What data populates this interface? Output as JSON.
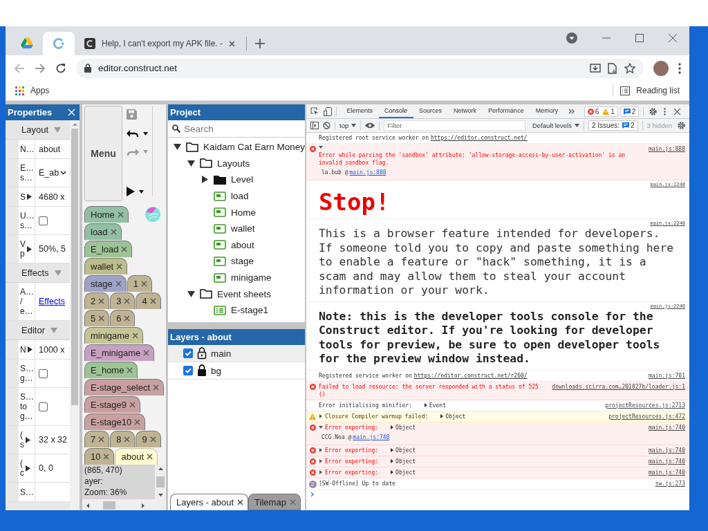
{
  "browser": {
    "tabs": [
      {
        "kind": "drive",
        "selected": false
      },
      {
        "kind": "construct",
        "selected": true
      },
      {
        "kind": "page",
        "title": "Help, I can't export my APK file. -",
        "selected": false
      }
    ],
    "address": "editor.construct.net",
    "bookmarks": [
      {
        "label": "Apps"
      }
    ],
    "reading_list": "Reading list"
  },
  "properties": {
    "title": "Properties",
    "sections": [
      {
        "title": "Layout",
        "expanded": true,
        "rows": [
          {
            "label": "N…",
            "kind": "text",
            "value": "about"
          },
          {
            "label": "E…\ns…",
            "kind": "select",
            "value": "E_ab"
          },
          {
            "label": "S",
            "kind": "expand",
            "value": "4680 x"
          },
          {
            "label": "U…\ns…",
            "kind": "check",
            "checked": false
          },
          {
            "label": "V\np",
            "kind": "expand",
            "value": "50%, 5"
          }
        ]
      },
      {
        "title": "Effects",
        "expanded": true,
        "rows": [
          {
            "label": "A…\n/\ne…",
            "kind": "link",
            "value": "Effects"
          }
        ]
      },
      {
        "title": "Editor",
        "expanded": true,
        "rows": [
          {
            "label": "N",
            "kind": "expand",
            "value": "1000 x"
          },
          {
            "label": "S…\ng…",
            "kind": "check",
            "checked": false
          },
          {
            "label": "S…\nto\ng…",
            "kind": "check",
            "checked": false
          },
          {
            "label": "(\ns",
            "kind": "expand",
            "value": "32 x 32"
          },
          {
            "label": "(\nc",
            "kind": "expand",
            "value": "0, 0"
          },
          {
            "label": "S…",
            "kind": "blank"
          }
        ]
      }
    ]
  },
  "editor_toolbar": {
    "menu": "Menu",
    "buttons": [
      {
        "kind": "save",
        "dropdown": false,
        "disabled": true
      },
      {
        "kind": "undo",
        "dropdown": true,
        "disabled": false
      },
      {
        "kind": "redo",
        "dropdown": true,
        "disabled": true
      },
      {
        "kind": "play",
        "dropdown": true,
        "disabled": false
      }
    ]
  },
  "layout_tabs": {
    "rows": [
      [
        {
          "label": "Home",
          "color": "#93bfa3",
          "selected": false
        }
      ],
      [
        {
          "label": "load",
          "color": "#93bfa3",
          "selected": false
        }
      ],
      [
        {
          "label": "E_load",
          "color": "#9dc495",
          "selected": false
        }
      ],
      [
        {
          "label": "wallet",
          "color": "#bdbd8e",
          "selected": false
        }
      ],
      [
        {
          "label": "stage",
          "color": "#9ea3c7",
          "selected": false
        },
        {
          "label": "1",
          "color": "#bfb393",
          "selected": false
        }
      ],
      [
        {
          "label": "2",
          "color": "#bfb393",
          "selected": false
        },
        {
          "label": "3",
          "color": "#bfb393",
          "selected": false
        },
        {
          "label": "4",
          "color": "#bfb393",
          "selected": false
        }
      ],
      [
        {
          "label": "5",
          "color": "#bfb393",
          "selected": false
        },
        {
          "label": "6",
          "color": "#bfb393",
          "selected": false
        }
      ],
      [
        {
          "label": "minigame",
          "color": "#c5c596",
          "selected": false
        }
      ],
      [
        {
          "label": "E_minigame",
          "color": "#c7a0c2",
          "selected": false
        }
      ],
      [
        {
          "label": "E_home",
          "color": "#9dc495",
          "selected": false
        }
      ],
      [
        {
          "label": "E-stage_select",
          "color": "#c9a0a0",
          "selected": false
        }
      ],
      [
        {
          "label": "E-stage9",
          "color": "#c9a0a0",
          "selected": false
        }
      ],
      [
        {
          "label": "E-stage10",
          "color": "#c9a0a0",
          "selected": false
        }
      ],
      [
        {
          "label": "7",
          "color": "#bfb393",
          "selected": false
        },
        {
          "label": "8",
          "color": "#bfb393",
          "selected": false
        },
        {
          "label": "9",
          "color": "#bfb393",
          "selected": false
        }
      ],
      [
        {
          "label": "10",
          "color": "#bfb393",
          "selected": false
        },
        {
          "label": "about",
          "selected": true
        }
      ]
    ]
  },
  "status": [
    "(865, 470)",
    "ayer:",
    "Zoom: 36%"
  ],
  "project": {
    "title": "Project",
    "search": {
      "placeholder": "Search"
    },
    "tree": [
      {
        "label": "Kaidam Cat Earn Money",
        "kind": "folder",
        "expanded": true,
        "children": [
          {
            "label": "Layouts",
            "kind": "folder",
            "expanded": true,
            "children": [
              {
                "label": "Level",
                "kind": "subfolder",
                "expanded": false
              },
              {
                "label": "load",
                "kind": "layout"
              },
              {
                "label": "Home",
                "kind": "layout"
              },
              {
                "label": "wallet",
                "kind": "layout"
              },
              {
                "label": "about",
                "kind": "layout"
              },
              {
                "label": "stage",
                "kind": "layout"
              },
              {
                "label": "minigame",
                "kind": "layout"
              }
            ]
          },
          {
            "label": "Event sheets",
            "kind": "folder",
            "expanded": true,
            "children": [
              {
                "label": "E-stage1",
                "kind": "event-sheet"
              }
            ]
          }
        ]
      }
    ]
  },
  "layers": {
    "title": "Layers - about",
    "items": [
      {
        "name": "main",
        "visible": true,
        "locked": false,
        "selected": true
      },
      {
        "name": "bg",
        "visible": true,
        "locked": true,
        "selected": false
      }
    ]
  },
  "bottom_tabs": [
    {
      "label": "Layers - about",
      "selected": true
    },
    {
      "label": "Tilemap",
      "selected": false
    }
  ],
  "devtools": {
    "tabs": [
      {
        "label": "Elements",
        "selected": false
      },
      {
        "label": "Console",
        "selected": true
      },
      {
        "label": "Sources",
        "selected": false
      },
      {
        "label": "Network",
        "selected": false
      },
      {
        "label": "Performance",
        "selected": false
      },
      {
        "label": "Memory",
        "selected": false
      }
    ],
    "errors": "6",
    "warnings": "1",
    "messages": "2",
    "context": "top",
    "filter": {
      "placeholder": "Filter"
    },
    "levels": "Default levels",
    "issues": {
      "label": "2 Issues:",
      "count": "2"
    },
    "hidden": "3 hidden",
    "console": [
      {
        "kind": "info",
        "text": "Registered root service worker on",
        "link": "https://editor.construct.net/"
      },
      {
        "kind": "error",
        "expanded": true,
        "text": "Error while parsing the 'sandbox' attribute: 'allow-storage-access-by-user-activation' is an invalid sandbox flag.",
        "source": "main.js:888",
        "stack": "la.bub @",
        "stack_link": "main.js:888"
      },
      {
        "kind": "stop",
        "text": "Stop!",
        "source": "main.js:2240"
      },
      {
        "kind": "banner",
        "text": "This is a browser feature intended for developers. If someone told you to copy and paste something here to enable a feature or \"hack\" something, it is a scam and may allow them to steal your account information or your work.",
        "source": "main.js:2240"
      },
      {
        "kind": "banner-bold",
        "text": "Note: this is the developer tools console for the Construct editor. If you're looking for developer tools for preview, be sure to open developer tools for the preview window instead.",
        "source": "main.js:2240"
      },
      {
        "kind": "info",
        "text": "Registered service worker on",
        "link": "https://editor.construct.net/r260/",
        "source": "main.js:701"
      },
      {
        "kind": "error",
        "text": "Failed to load resource: the server responded with a status of 525 ()",
        "source": "downloads.scirra.com…201027b/loader.js:1"
      },
      {
        "kind": "info",
        "text": "Error initialising minifier:",
        "object": "Event",
        "source": "projectResources.js:2713"
      },
      {
        "kind": "warning",
        "expanded": false,
        "text": "Closure Compiler warmup failed:",
        "object": "Object",
        "source": "projectResources.js:472"
      },
      {
        "kind": "error",
        "expanded": true,
        "text": "Error exporting:",
        "object": "Object",
        "source": "main.js:740",
        "stack": "CCG.Noa @",
        "stack_link": "main.js:740"
      },
      {
        "kind": "error",
        "expanded": false,
        "text": "Error exporting:",
        "object": "Object",
        "source": "main.js:740"
      },
      {
        "kind": "error",
        "expanded": false,
        "text": "Error exporting:",
        "object": "Object",
        "source": "main.js:740"
      },
      {
        "kind": "error",
        "expanded": false,
        "text": "Error exporting:",
        "object": "Object",
        "source": "main.js:740"
      },
      {
        "kind": "info",
        "count": "2",
        "text": "[SW-Offline] Up to date",
        "source": "sw.js:273"
      }
    ]
  }
}
